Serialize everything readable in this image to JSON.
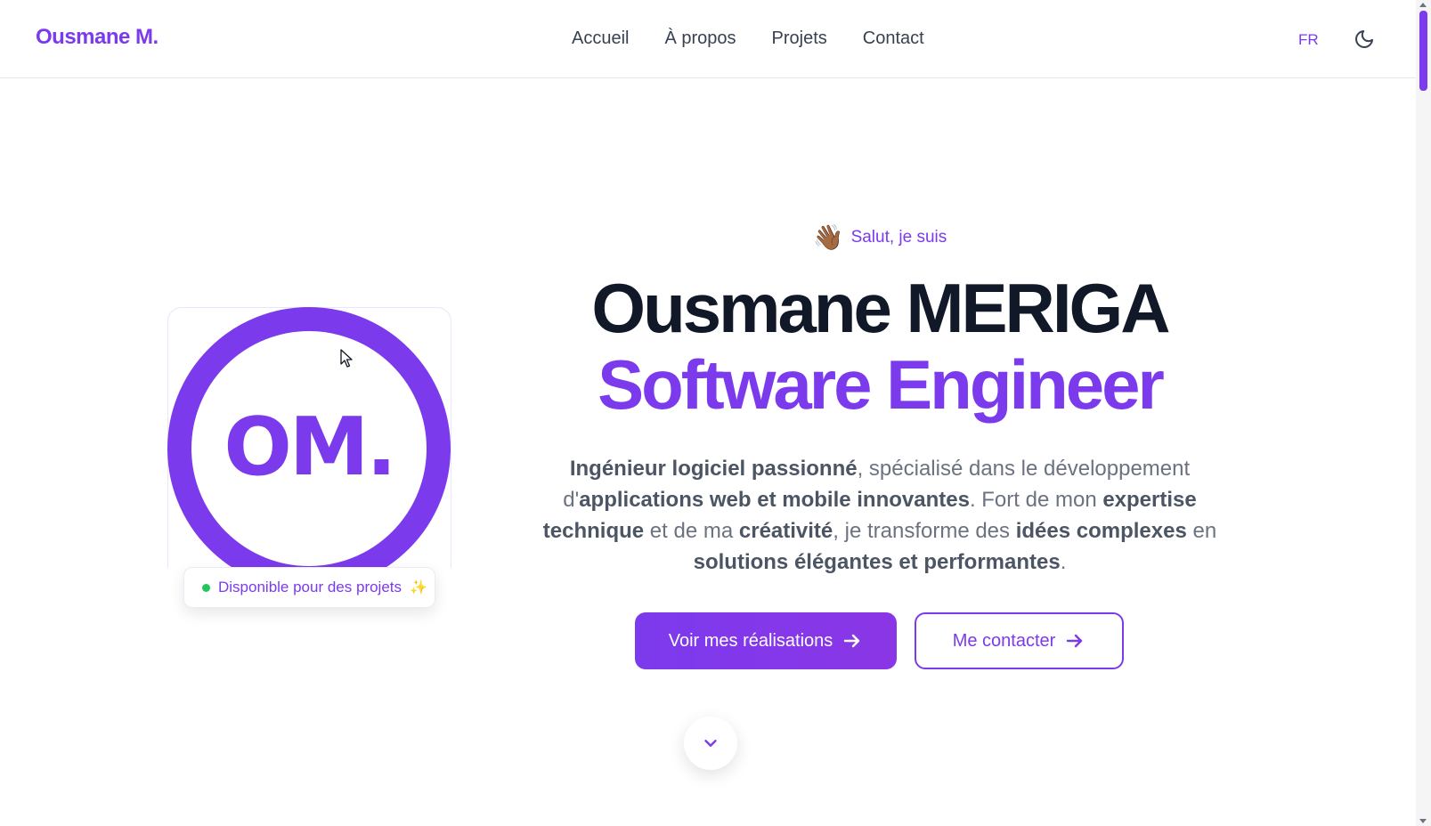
{
  "header": {
    "brand": "Ousmane M.",
    "nav": [
      "Accueil",
      "À propos",
      "Projets",
      "Contact"
    ],
    "language": "FR",
    "theme_icon": "moon-icon"
  },
  "profile": {
    "initials": "OM.",
    "badge_text": "Disponible pour des projets",
    "badge_icon": "sparkle-icon"
  },
  "hero": {
    "greeting": "Salut, je suis",
    "wave_icon": "👋🏾",
    "name": "Ousmane MERIGA",
    "role": "Software Engineer",
    "description": [
      {
        "text": "Ingénieur logiciel passionné",
        "bold": true
      },
      {
        "text": ", spécialisé dans le développement d'",
        "bold": false
      },
      {
        "text": "applications web et mobile innovantes",
        "bold": true
      },
      {
        "text": ". Fort de mon ",
        "bold": false
      },
      {
        "text": "expertise technique",
        "bold": true
      },
      {
        "text": " et de ma ",
        "bold": false
      },
      {
        "text": "créativité",
        "bold": true
      },
      {
        "text": ", je transforme des ",
        "bold": false
      },
      {
        "text": "idées complexes",
        "bold": true
      },
      {
        "text": " en ",
        "bold": false
      },
      {
        "text": "solutions élégantes et performantes",
        "bold": true
      },
      {
        "text": ".",
        "bold": false
      }
    ],
    "cta_primary": "Voir mes réalisations",
    "cta_secondary": "Me contacter"
  },
  "colors": {
    "accent": "#7c3aed",
    "heading": "#111827",
    "body_text": "#6b7280",
    "status_available": "#22c55e"
  }
}
